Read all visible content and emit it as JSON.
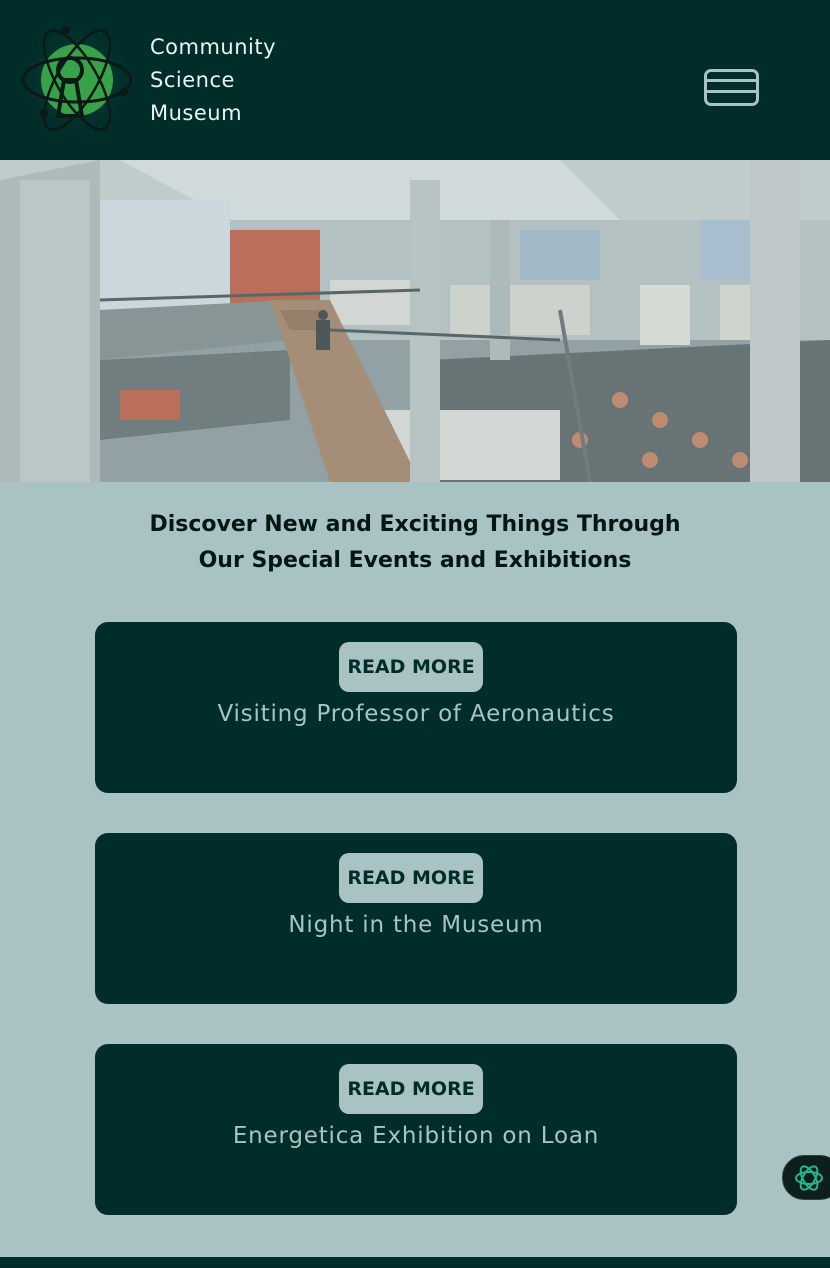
{
  "header": {
    "logo_icon": "atom-keyhole-icon",
    "site_name_lines": [
      "Community",
      "Science",
      "Museum"
    ],
    "menu_icon": "hamburger-menu-icon"
  },
  "hero": {
    "image": "library-atrium-photo"
  },
  "intro": {
    "lines": [
      "Discover New and Exciting Things Through",
      "Our Special Events and Exhibitions"
    ]
  },
  "events": [
    {
      "button_label": "READ MORE",
      "title": "Visiting Professor of Aeronautics"
    },
    {
      "button_label": "READ MORE",
      "title": "Night in the Museum"
    },
    {
      "button_label": "READ MORE",
      "title": "Energetica Exhibition on Loan"
    }
  ],
  "floating_button": {
    "icon": "ai-assistant-icon"
  },
  "colors": {
    "header_bg": "#002d2a",
    "page_bg": "#a9c3c4",
    "logo_green": "#3aa14b",
    "accent_teal": "#28b58a"
  }
}
